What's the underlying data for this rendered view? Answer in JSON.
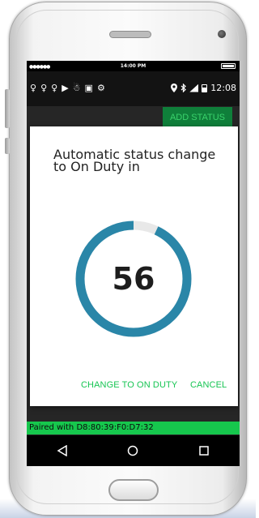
{
  "ios_status": {
    "dots": "●●●●●●",
    "time": "14:00 PM"
  },
  "android_status": {
    "notification_icons": [
      "♀",
      "♀",
      "♀",
      "▶",
      "☃",
      "▣",
      "⚙"
    ],
    "time": "12:08"
  },
  "toolbar": {
    "add_status_label": "ADD STATUS"
  },
  "dialog": {
    "title": "Automatic status change to On Duty in",
    "countdown": "56",
    "countdown_progress": 0.93,
    "change_button_label": "CHANGE TO ON DUTY",
    "cancel_button_label": "CANCEL"
  },
  "bottom_banner": {
    "paired_text": "Paired with D8:80:39:F0:D7:32"
  },
  "colors": {
    "ring_accent": "#2a86a8",
    "ring_track": "#e8e8e8",
    "action_green": "#17c553",
    "banner_green": "#16c74d"
  },
  "icons": {
    "location": "location-icon",
    "bluetooth": "bluetooth-icon",
    "signal": "signal-icon",
    "battery": "battery-icon",
    "back": "back-icon",
    "home": "home-icon",
    "recents": "recents-icon"
  }
}
